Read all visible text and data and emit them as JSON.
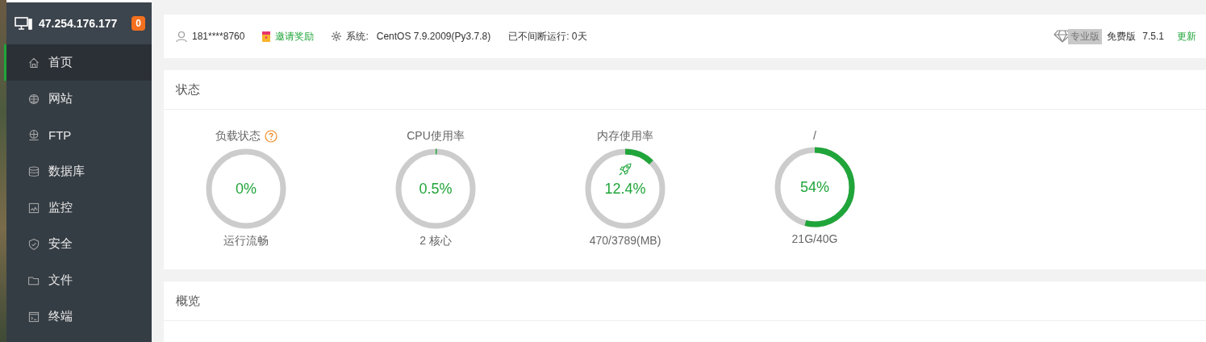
{
  "sidebar": {
    "host": "47.254.176.177",
    "badge": "0",
    "items": [
      {
        "label": "首页",
        "kind": "home",
        "selected": true
      },
      {
        "label": "网站",
        "kind": "globe",
        "selected": false
      },
      {
        "label": "FTP",
        "kind": "ftp",
        "selected": false
      },
      {
        "label": "数据库",
        "kind": "database",
        "selected": false
      },
      {
        "label": "监控",
        "kind": "monitor",
        "selected": false
      },
      {
        "label": "安全",
        "kind": "shield",
        "selected": false
      },
      {
        "label": "文件",
        "kind": "folder",
        "selected": false
      },
      {
        "label": "终端",
        "kind": "terminal",
        "selected": false
      }
    ]
  },
  "top_bar": {
    "user": "181****8760",
    "invite": "邀请奖励",
    "system_label": "系统:",
    "system": "CentOS 7.9.2009(Py3.7.8)",
    "uptime": "已不间断运行: 0天",
    "pro_badge": "专业版",
    "edition": "免费版",
    "version": "7.5.1",
    "update": "更新"
  },
  "status": {
    "title": "状态",
    "gauges": [
      {
        "kind": "load",
        "title": "负载状态",
        "value": "0%",
        "caption": "运行流畅",
        "level": 0
      },
      {
        "kind": "cpu",
        "title": "CPU使用率",
        "value": "0.5%",
        "caption": "2 核心",
        "level": 0.005
      },
      {
        "kind": "memory",
        "title": "内存使用率",
        "value": "12.4%",
        "caption": "470/3789(MB)",
        "level": 0.124
      },
      {
        "kind": "disk",
        "title": "/",
        "value": "54%",
        "caption": "21G/40G",
        "level": 0.54
      }
    ]
  },
  "overview": {
    "title": "概览"
  }
}
